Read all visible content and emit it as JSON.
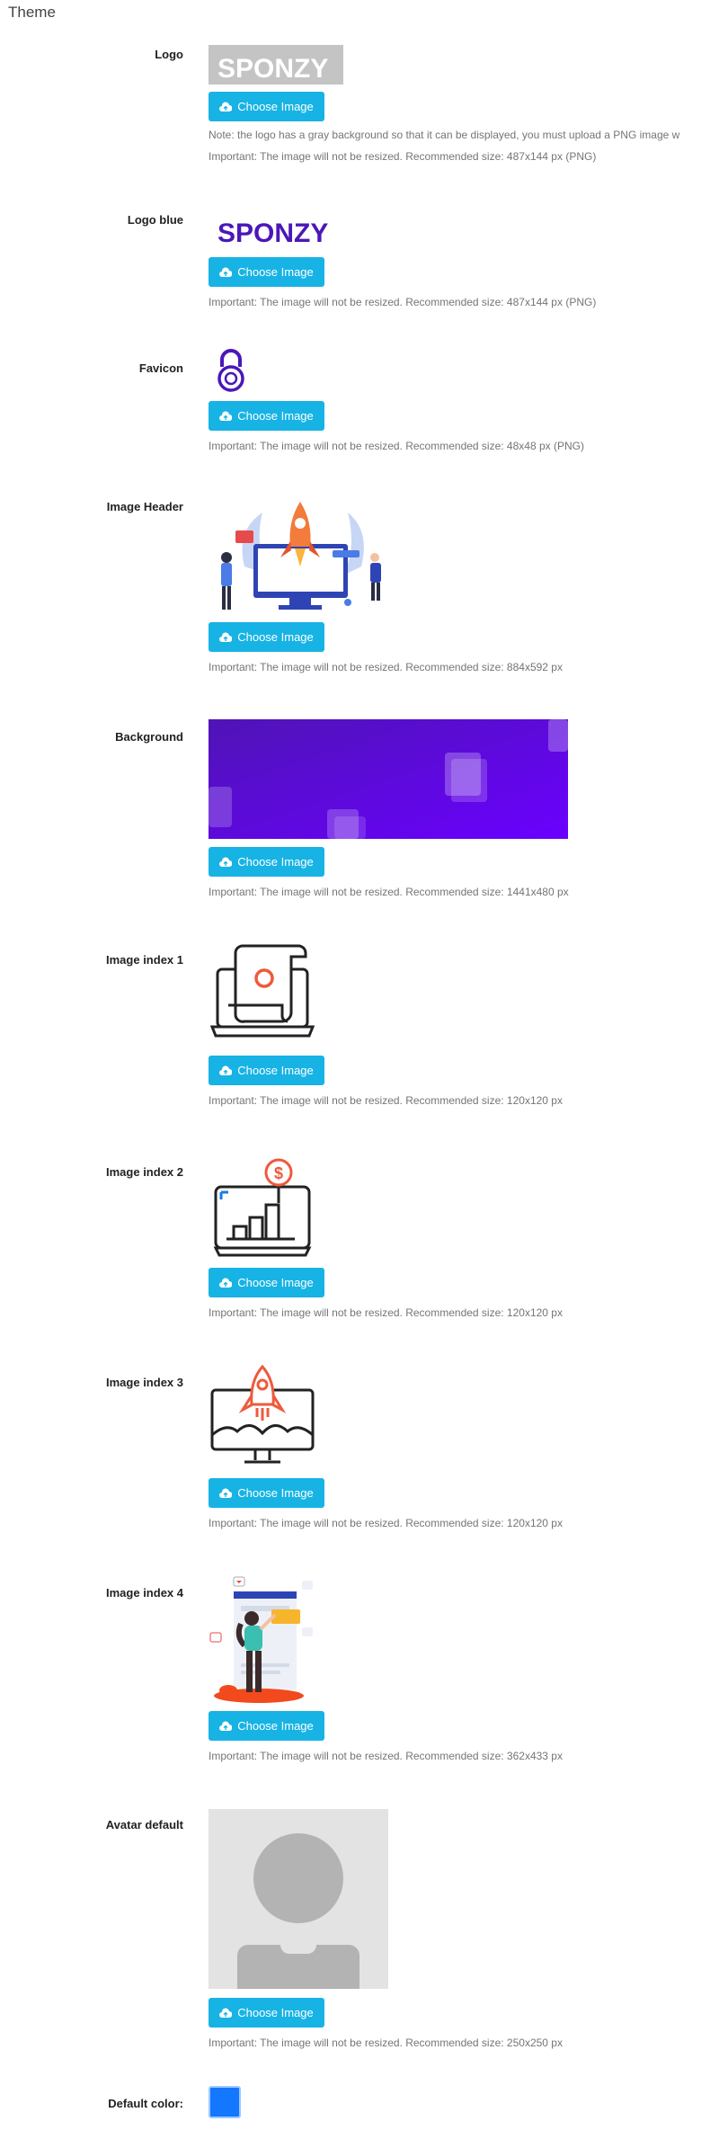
{
  "section_title": "Theme",
  "choose_label": "Choose Image",
  "fields": [
    {
      "label": "Logo",
      "brand_text": "SPONZY",
      "note": "Note: the logo has a gray background so that it can be displayed, you must upload a PNG image w",
      "important": "Important: The image will not be resized. Recommended size: 487x144 px (PNG)"
    },
    {
      "label": "Logo blue",
      "brand_text": "SPONZY",
      "important": "Important: The image will not be resized. Recommended size: 487x144 px (PNG)"
    },
    {
      "label": "Favicon",
      "important": "Important: The image will not be resized. Recommended size: 48x48 px (PNG)"
    },
    {
      "label": "Image Header",
      "important": "Important: The image will not be resized. Recommended size: 884x592 px"
    },
    {
      "label": "Background",
      "important": "Important: The image will not be resized. Recommended size: 1441x480 px"
    },
    {
      "label": "Image index 1",
      "important": "Important: The image will not be resized. Recommended size: 120x120 px"
    },
    {
      "label": "Image index 2",
      "important": "Important: The image will not be resized. Recommended size: 120x120 px"
    },
    {
      "label": "Image index 3",
      "important": "Important: The image will not be resized. Recommended size: 120x120 px"
    },
    {
      "label": "Image index 4",
      "important": "Important: The image will not be resized. Recommended size: 362x433 px"
    },
    {
      "label": "Avatar default",
      "important": "Important: The image will not be resized. Recommended size: 250x250 px"
    },
    {
      "label": "Default color:"
    }
  ],
  "colors": {
    "accent": "#17b3e4",
    "brand_purple": "#4b17b8",
    "default_color": "#1377ff"
  }
}
